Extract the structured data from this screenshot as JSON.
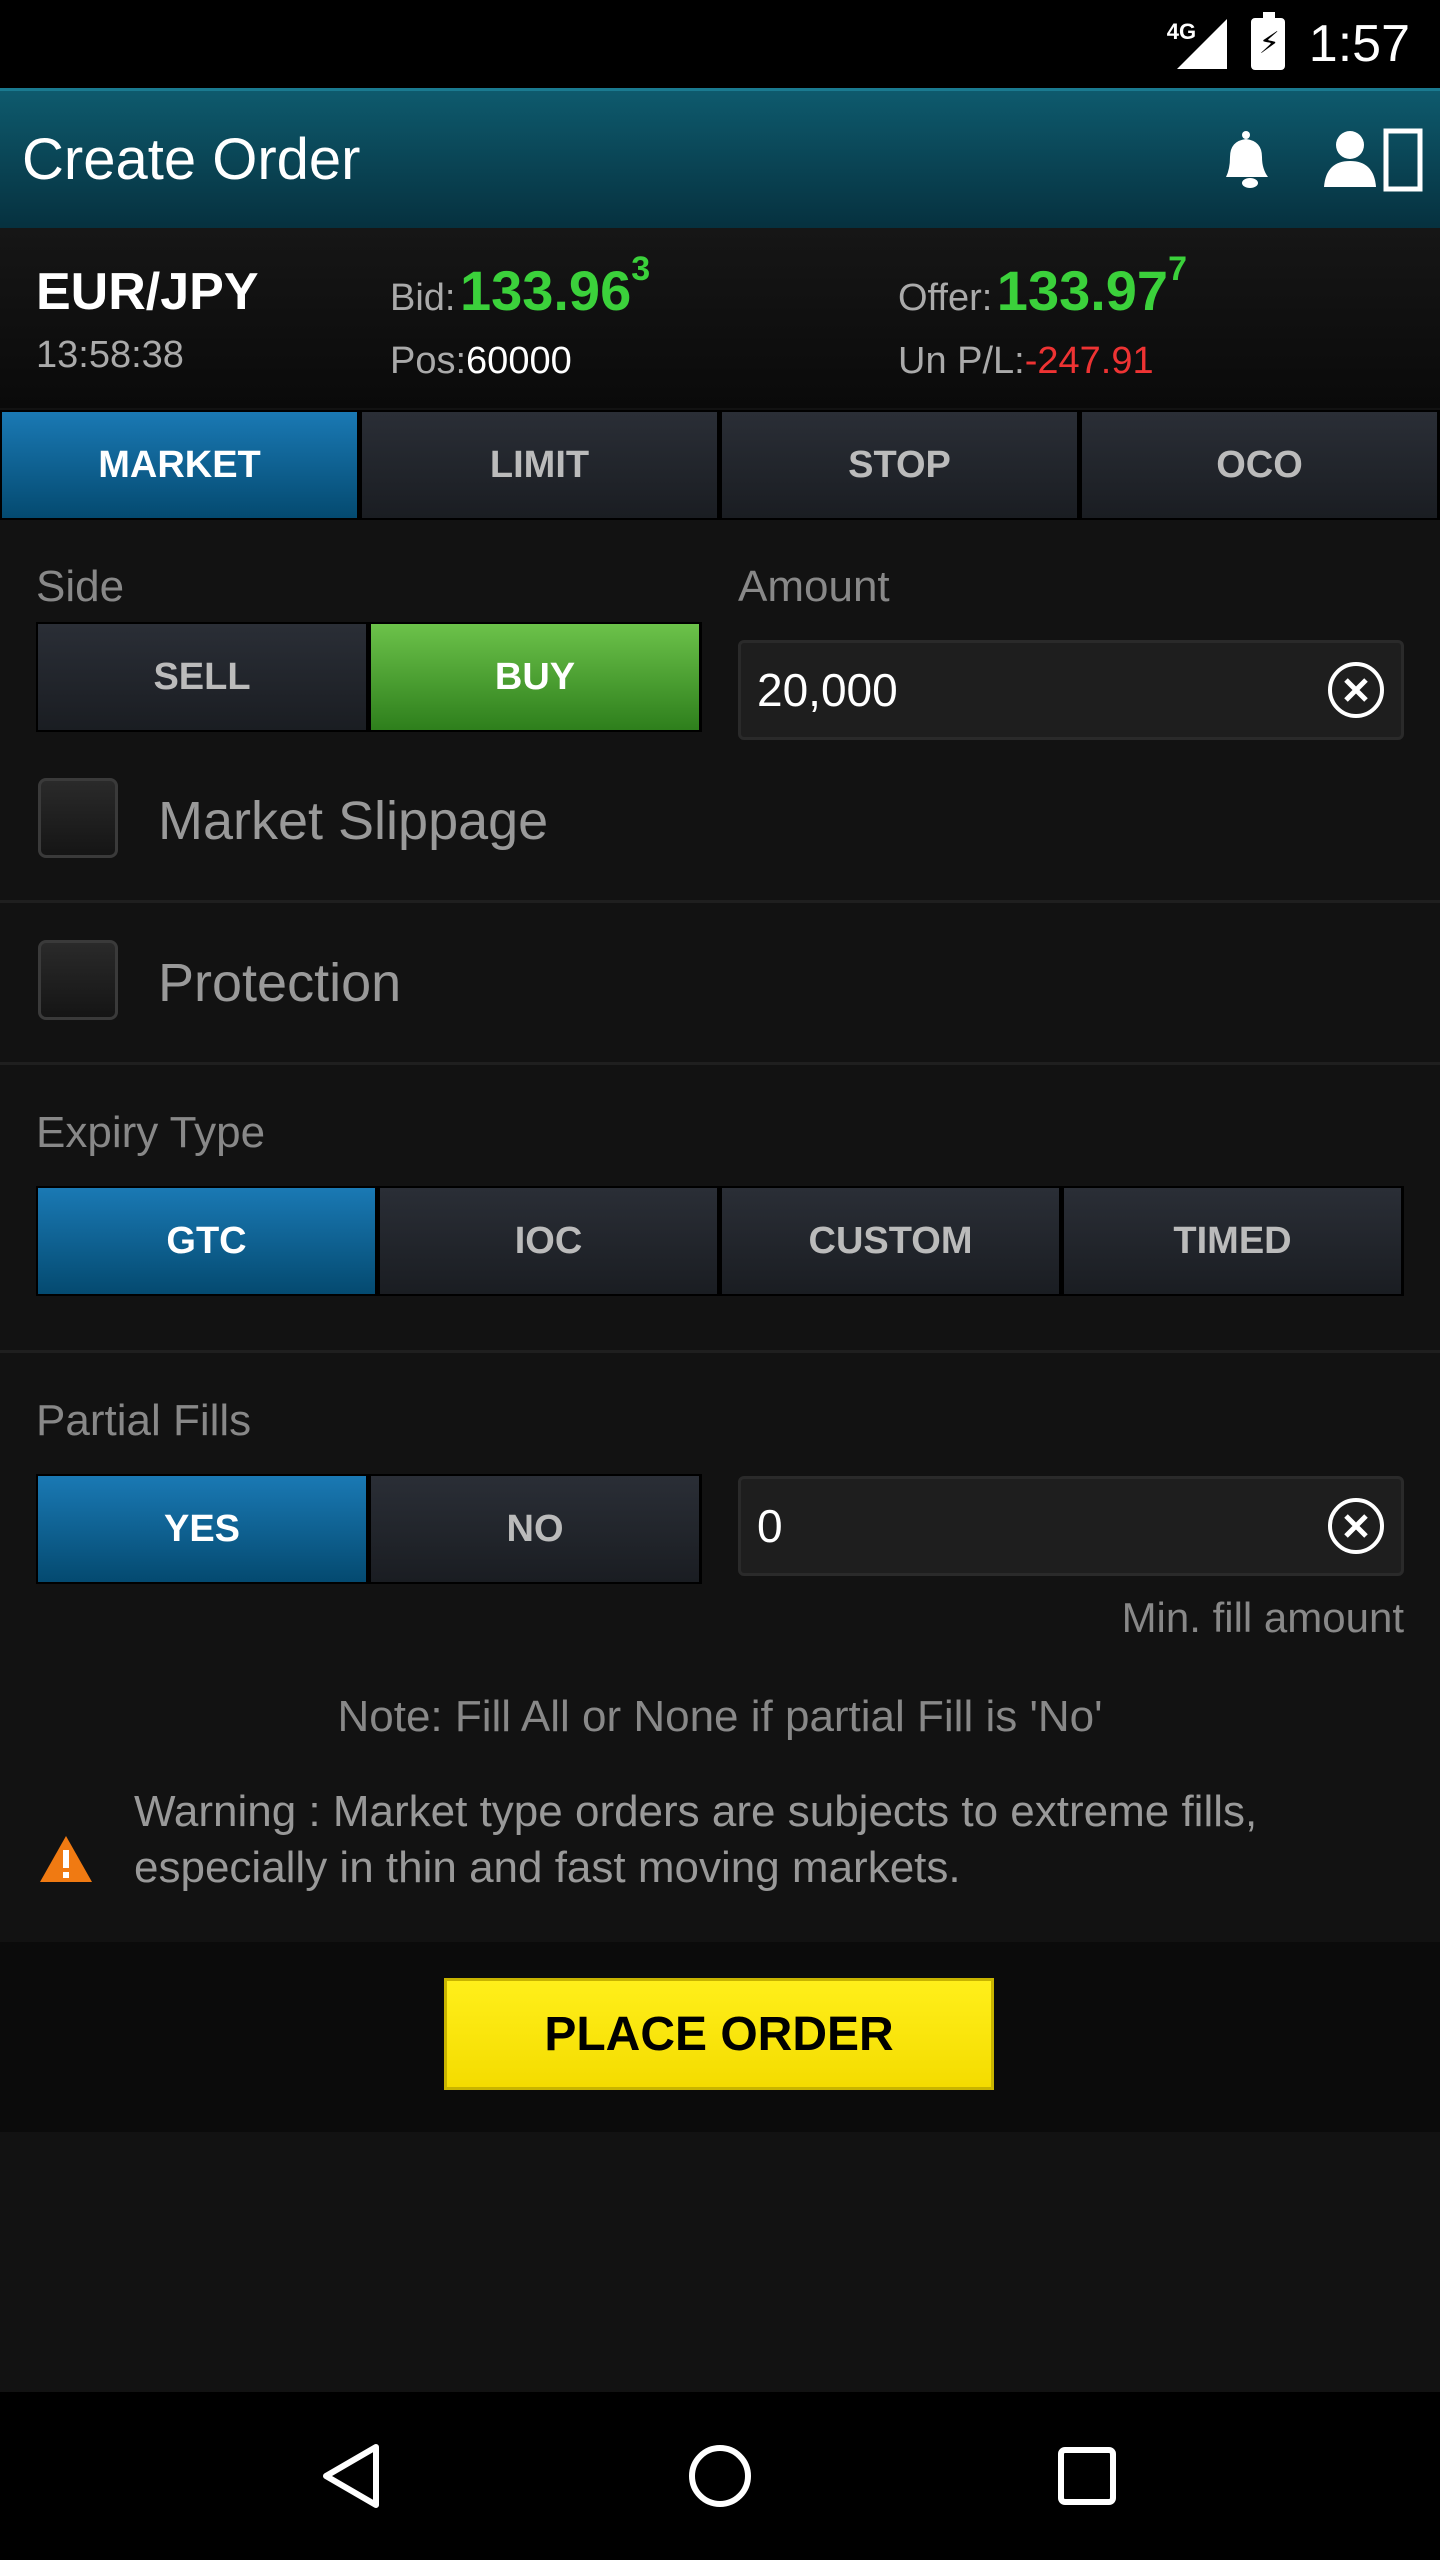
{
  "status_bar": {
    "network": "4G",
    "time": "1:57"
  },
  "app_bar": {
    "title": "Create Order"
  },
  "quote": {
    "pair": "EUR/JPY",
    "time": "13:58:38",
    "bid_label": "Bid:",
    "bid_main": "133.96",
    "bid_pip": "3",
    "offer_label": "Offer:",
    "offer_main": "133.97",
    "offer_pip": "7",
    "pos_label": "Pos:",
    "pos_value": "60000",
    "pl_label": "Un P/L:",
    "pl_value": "-247.91"
  },
  "order_tabs": [
    "MARKET",
    "LIMIT",
    "STOP",
    "OCO"
  ],
  "side": {
    "label": "Side",
    "sell": "SELL",
    "buy": "BUY"
  },
  "amount": {
    "label": "Amount",
    "value": "20,000"
  },
  "market_slippage": {
    "label": "Market Slippage"
  },
  "protection": {
    "label": "Protection"
  },
  "expiry": {
    "label": "Expiry Type",
    "options": [
      "GTC",
      "IOC",
      "CUSTOM",
      "TIMED"
    ]
  },
  "partial_fills": {
    "label": "Partial Fills",
    "yes": "YES",
    "no": "NO",
    "min_value": "0",
    "min_hint": "Min. fill amount"
  },
  "note": "Note: Fill All or None if partial Fill is 'No'",
  "warning": "Warning : Market type orders are subjects to extreme fills, especially in thin and fast moving markets.",
  "place_order": "PLACE ORDER",
  "colors": {
    "accent_blue": "#1a79b4",
    "buy_green": "#6cc24a",
    "price_green": "#3bd13b",
    "loss_red": "#ee3333",
    "place_yellow": "#ffef1a"
  }
}
